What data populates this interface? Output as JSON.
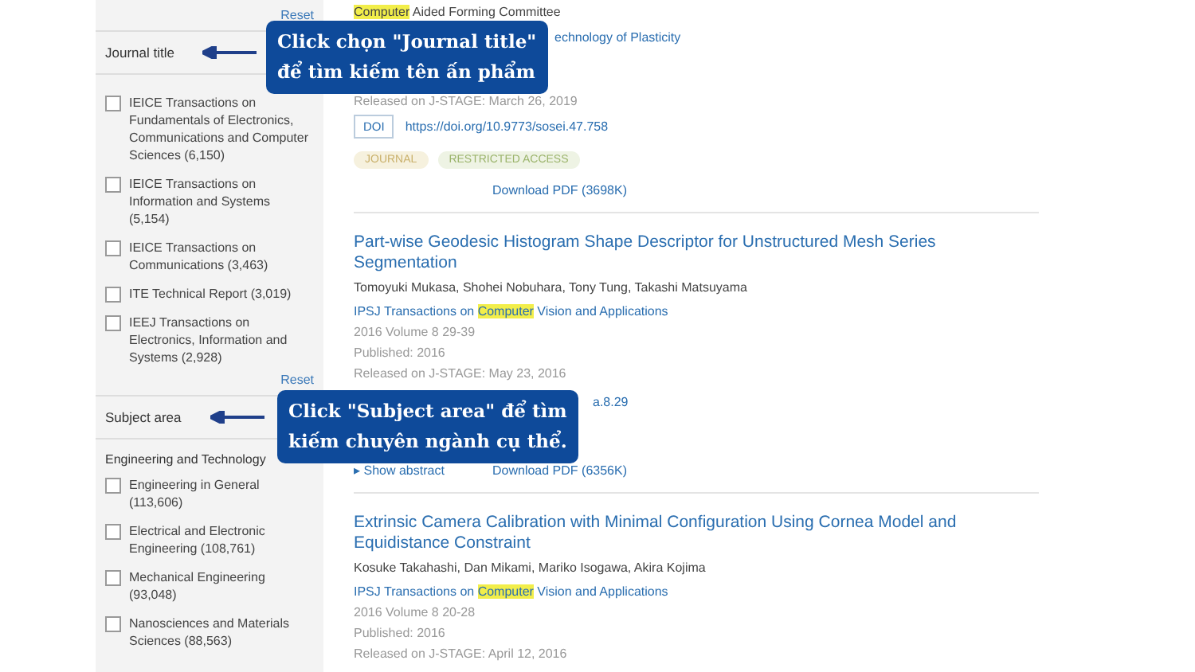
{
  "sidebar": {
    "sections": [
      {
        "reset": "Reset",
        "title": "Journal title",
        "items": [
          {
            "label": "IEICE Transactions on Fundamentals of Electronics, Communications and Computer Sciences (6,150)",
            "checked": false
          },
          {
            "label": "IEICE Transactions on Information and Systems (5,154)",
            "checked": false
          },
          {
            "label": "IEICE Transactions on Communications (3,463)",
            "checked": false
          },
          {
            "label": "ITE Technical Report (3,019)",
            "checked": false
          },
          {
            "label": "IEEJ Transactions on Electronics, Information and Systems (2,928)",
            "checked": false
          }
        ]
      },
      {
        "reset": "Reset",
        "title": "Subject area",
        "group": "Engineering and Technology",
        "items": [
          {
            "label": "Engineering in General (113,606)",
            "checked": false
          },
          {
            "label": "Electrical and Electronic Engineering (108,761)",
            "checked": false
          },
          {
            "label": "Mechanical Engineering (93,048)",
            "checked": false
          },
          {
            "label": "Nanosciences and Materials Sciences (88,563)",
            "checked": false
          }
        ]
      }
    ]
  },
  "results": [
    {
      "affiliation": [
        {
          "text": "Computer",
          "highlighted": true
        },
        {
          "text": " Aided Forming Committee",
          "highlighted": false
        }
      ],
      "journal_fragment": "echnology of Plasticity",
      "released": "Released on J-STAGE: March 26, 2019",
      "doi_label": "DOI",
      "doi": "https://doi.org/10.9773/sosei.47.758",
      "tags": [
        "JOURNAL",
        "RESTRICTED ACCESS"
      ],
      "download": "Download PDF (3698K)"
    },
    {
      "title": "Part-wise Geodesic Histogram Shape Descriptor for Unstructured Mesh Series Segmentation",
      "authors": "Tomoyuki Mukasa, Shohei Nobuhara, Tony Tung, Takashi Matsuyama",
      "journal": [
        {
          "text": "IPSJ Transactions on ",
          "highlighted": false
        },
        {
          "text": "Computer",
          "highlighted": true
        },
        {
          "text": " Vision and Applications",
          "highlighted": false
        }
      ],
      "volume": "2016 Volume 8 29-39",
      "published": "Published: 2016",
      "released": "Released on J-STAGE: May 23, 2016",
      "doi_fragment": "a.8.29",
      "abstract_marker": "▸",
      "show_abstract": "Show abstract",
      "download": "Download PDF (6356K)"
    },
    {
      "title": "Extrinsic Camera Calibration with Minimal Configuration Using Cornea Model and Equidistance Constraint",
      "authors": "Kosuke Takahashi, Dan Mikami, Mariko Isogawa, Akira Kojima",
      "journal": [
        {
          "text": "IPSJ Transactions on ",
          "highlighted": false
        },
        {
          "text": "Computer",
          "highlighted": true
        },
        {
          "text": " Vision and Applications",
          "highlighted": false
        }
      ],
      "volume": "2016 Volume 8 20-28",
      "published": "Published: 2016",
      "released": "Released on J-STAGE: April 12, 2016"
    }
  ],
  "callouts": [
    {
      "lines": [
        "Click chọn \"Journal title\"",
        "để tìm kiếm tên ấn phẩm"
      ]
    },
    {
      "lines": [
        "Click \"Subject area\" để tìm",
        "kiếm chuyên ngành cụ thể."
      ]
    }
  ]
}
